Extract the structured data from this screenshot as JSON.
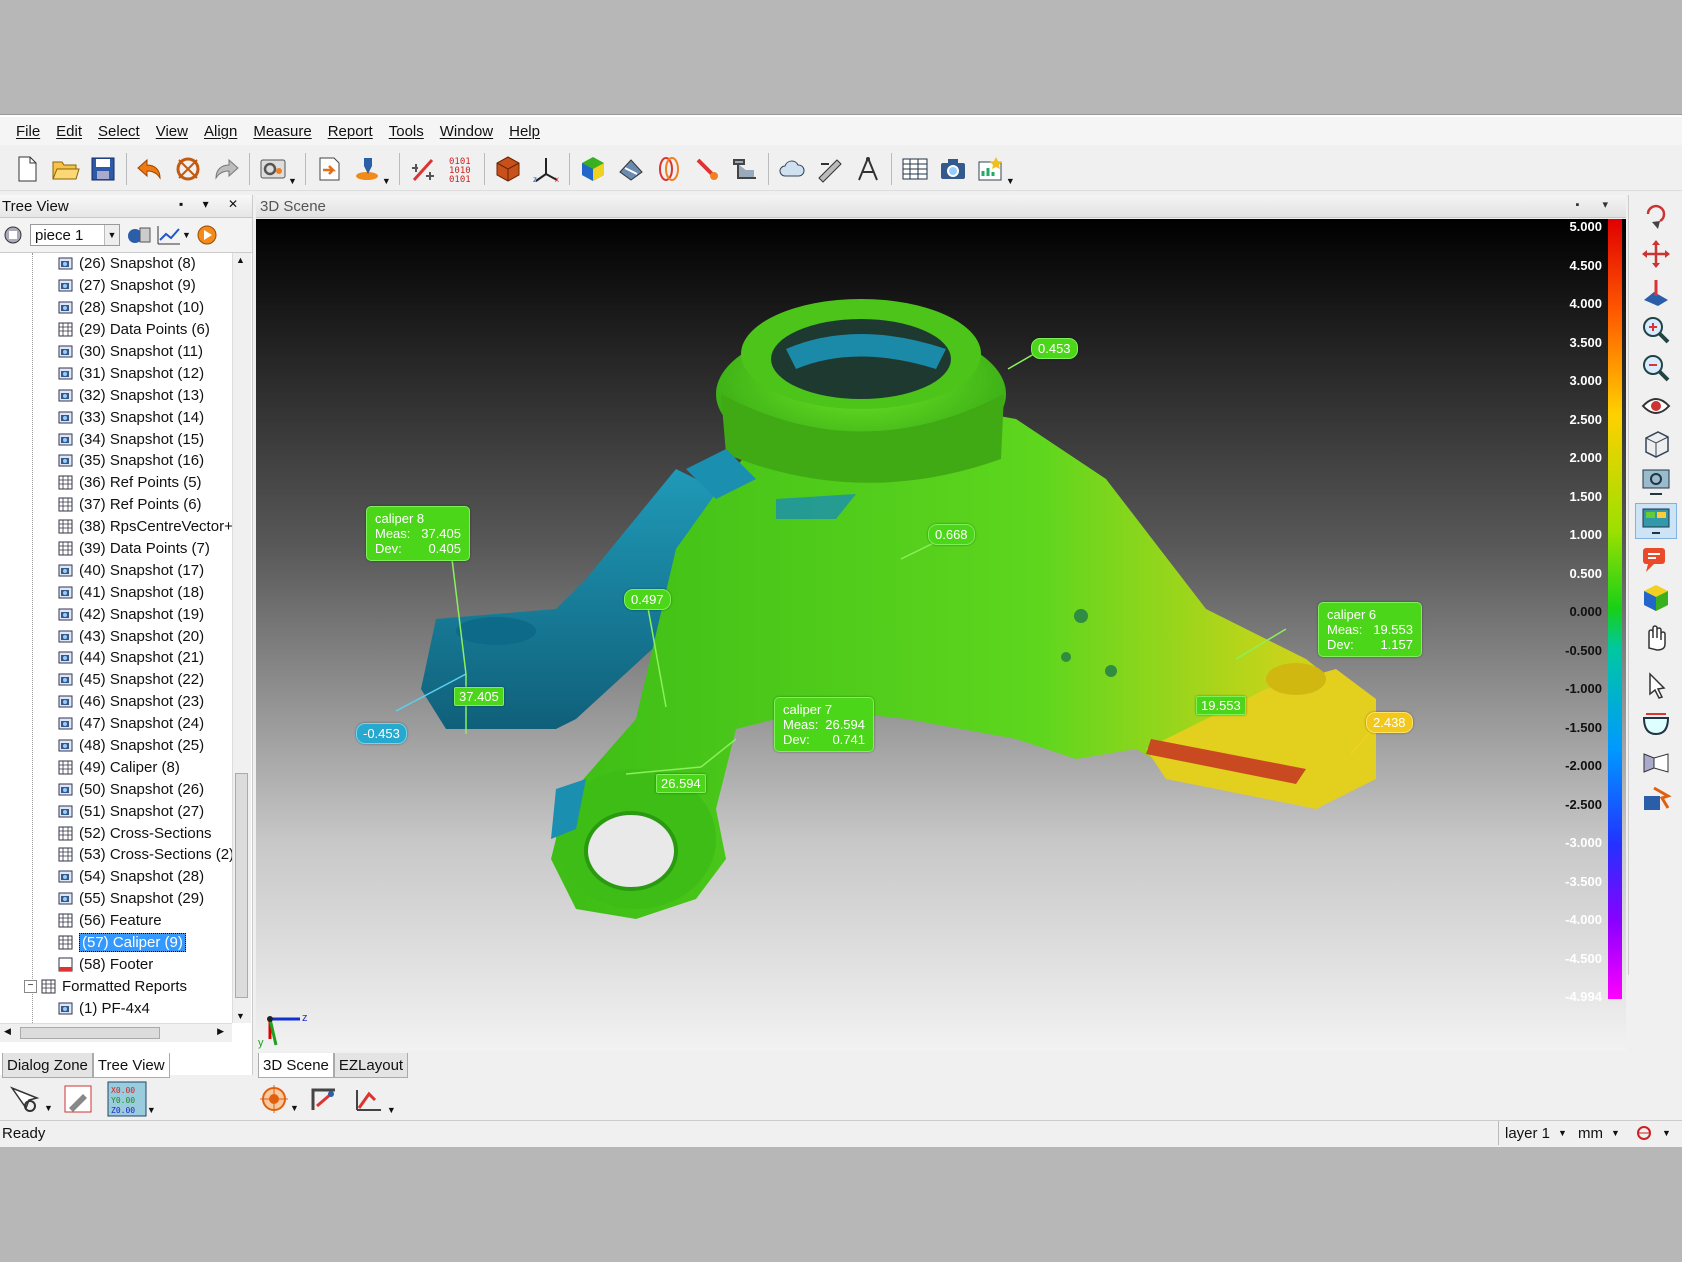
{
  "menu": [
    "File",
    "Edit",
    "Select",
    "View",
    "Align",
    "Measure",
    "Report",
    "Tools",
    "Window",
    "Help"
  ],
  "tree_view": {
    "title": "Tree View",
    "piece": "piece 1",
    "items": [
      {
        "label": "(26) Snapshot (8)",
        "icon": "snapshot-icon"
      },
      {
        "label": "(27) Snapshot (9)",
        "icon": "snapshot-icon"
      },
      {
        "label": "(28) Snapshot (10)",
        "icon": "snapshot-icon"
      },
      {
        "label": "(29) Data Points (6)",
        "icon": "table-icon"
      },
      {
        "label": "(30) Snapshot (11)",
        "icon": "snapshot-icon"
      },
      {
        "label": "(31) Snapshot (12)",
        "icon": "snapshot-icon"
      },
      {
        "label": "(32) Snapshot (13)",
        "icon": "snapshot-icon"
      },
      {
        "label": "(33) Snapshot (14)",
        "icon": "snapshot-icon"
      },
      {
        "label": "(34) Snapshot (15)",
        "icon": "snapshot-icon"
      },
      {
        "label": "(35) Snapshot (16)",
        "icon": "snapshot-icon"
      },
      {
        "label": "(36) Ref Points (5)",
        "icon": "table-icon"
      },
      {
        "label": "(37) Ref Points (6)",
        "icon": "table-icon"
      },
      {
        "label": "(38) RpsCentreVector+",
        "icon": "table-icon"
      },
      {
        "label": "(39) Data Points (7)",
        "icon": "table-icon"
      },
      {
        "label": "(40) Snapshot (17)",
        "icon": "snapshot-icon"
      },
      {
        "label": "(41) Snapshot (18)",
        "icon": "snapshot-icon"
      },
      {
        "label": "(42) Snapshot (19)",
        "icon": "snapshot-icon"
      },
      {
        "label": "(43) Snapshot (20)",
        "icon": "snapshot-icon"
      },
      {
        "label": "(44) Snapshot (21)",
        "icon": "snapshot-icon"
      },
      {
        "label": "(45) Snapshot (22)",
        "icon": "snapshot-icon"
      },
      {
        "label": "(46) Snapshot (23)",
        "icon": "snapshot-icon"
      },
      {
        "label": "(47) Snapshot (24)",
        "icon": "snapshot-icon"
      },
      {
        "label": "(48) Snapshot (25)",
        "icon": "snapshot-icon"
      },
      {
        "label": "(49) Caliper (8)",
        "icon": "table-icon"
      },
      {
        "label": "(50) Snapshot (26)",
        "icon": "snapshot-icon"
      },
      {
        "label": "(51) Snapshot (27)",
        "icon": "snapshot-icon"
      },
      {
        "label": "(52) Cross-Sections",
        "icon": "table-icon"
      },
      {
        "label": "(53) Cross-Sections (2)",
        "icon": "table-icon"
      },
      {
        "label": "(54) Snapshot (28)",
        "icon": "snapshot-icon"
      },
      {
        "label": "(55) Snapshot (29)",
        "icon": "snapshot-icon"
      },
      {
        "label": "(56) Feature",
        "icon": "table-icon"
      },
      {
        "label": "(57) Caliper (9)",
        "icon": "table-icon",
        "selected": true
      },
      {
        "label": "(58) Footer",
        "icon": "footer-icon"
      }
    ],
    "formatted_reports": "Formatted Reports",
    "report_item": "(1) PF-4x4"
  },
  "left_tabs": [
    "Dialog Zone",
    "Tree View"
  ],
  "scene": {
    "title": "3D Scene",
    "tabs": [
      "3D Scene",
      "EZLayout"
    ],
    "axis_labels": {
      "z": "z",
      "y": "y"
    },
    "scale_labels": [
      "5.000",
      "4.500",
      "4.000",
      "3.500",
      "3.000",
      "2.500",
      "2.000",
      "1.500",
      "1.000",
      "0.500",
      "0.000",
      "-0.500",
      "-1.000",
      "-1.500",
      "-2.000",
      "-2.500",
      "-3.000",
      "-3.500",
      "-4.000",
      "-4.500",
      "-4.994"
    ],
    "annotations": {
      "a1": "0.453",
      "a2": "0.668",
      "a3": "0.497",
      "a4": "-0.453",
      "a5": "37.405",
      "a6": "26.594",
      "a7": "19.553",
      "a8": "2.438"
    },
    "calipers": {
      "c8": {
        "name": "caliper 8",
        "meas_label": "Meas:",
        "meas": "37.405",
        "dev_label": "Dev:",
        "dev": "0.405"
      },
      "c7": {
        "name": "caliper 7",
        "meas_label": "Meas:",
        "meas": "26.594",
        "dev_label": "Dev:",
        "dev": "0.741"
      },
      "c6": {
        "name": "caliper 6",
        "meas_label": "Meas:",
        "meas": "19.553",
        "dev_label": "Dev:",
        "dev": "1.157"
      }
    }
  },
  "status": {
    "text": "Ready",
    "layer": "layer 1",
    "unit": "mm"
  },
  "colors": {
    "in_tol": "#4cd619",
    "blue_zone": "#1a8fb0",
    "yellow_zone": "#f2d21a"
  }
}
